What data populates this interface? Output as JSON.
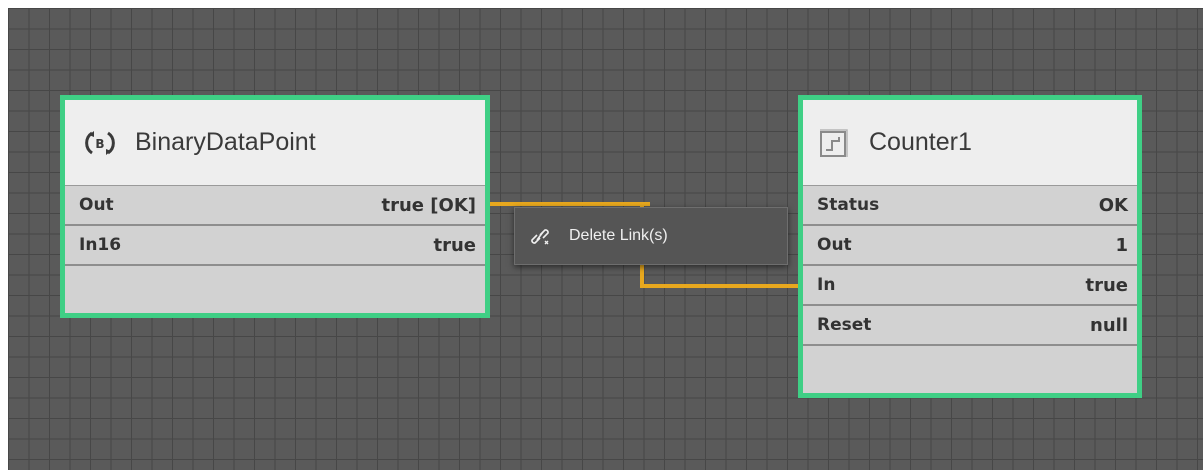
{
  "nodes": {
    "binary": {
      "title": "BinaryDataPoint",
      "icon": "binary-datapoint-icon",
      "rows": [
        {
          "label": "Out",
          "value": "true [OK]"
        },
        {
          "label": "In16",
          "value": "true"
        }
      ]
    },
    "counter": {
      "title": "Counter1",
      "icon": "counter-icon",
      "rows": [
        {
          "label": "Status",
          "value": "OK"
        },
        {
          "label": "Out",
          "value": "1"
        },
        {
          "label": "In",
          "value": "true"
        },
        {
          "label": "Reset",
          "value": "null"
        }
      ]
    }
  },
  "context_menu": {
    "items": [
      {
        "label": "Delete Link(s)",
        "icon": "unlink-icon"
      }
    ]
  },
  "colors": {
    "canvas": "#5a5a5a",
    "grid": "#474747",
    "node_border": "#3fcf85",
    "link": "#e8a81e"
  }
}
